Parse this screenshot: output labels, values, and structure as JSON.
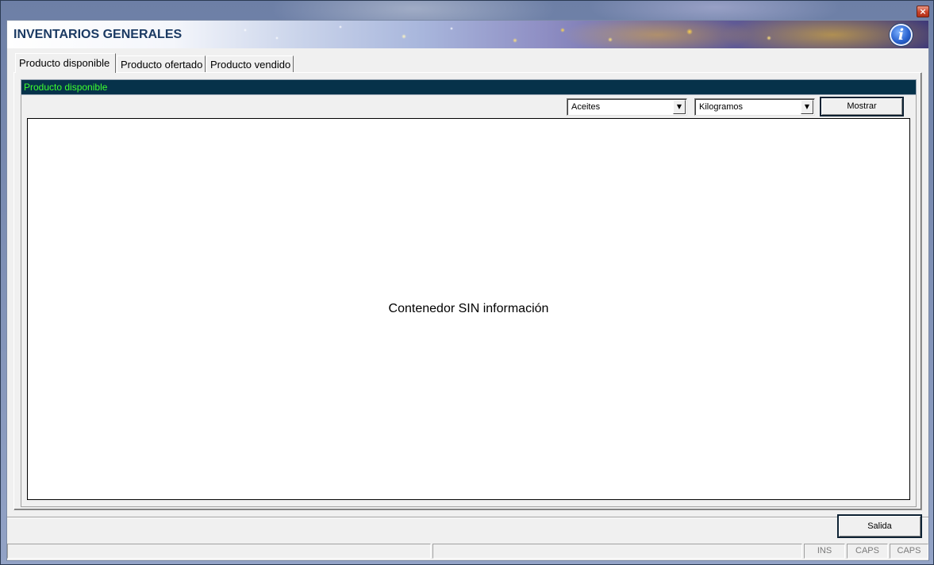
{
  "window": {
    "close_glyph": "×",
    "close_icon": "close-icon"
  },
  "banner": {
    "title": "INVENTARIOS GENERALES",
    "info_glyph": "i",
    "info_icon": "info-icon"
  },
  "tabs": [
    {
      "label": "Producto disponible",
      "active": true
    },
    {
      "label": "Producto ofertado",
      "active": false
    },
    {
      "label": "Producto vendido",
      "active": false
    }
  ],
  "panel": {
    "section_title": "Producto disponible",
    "product_select": {
      "value": "Aceites"
    },
    "unit_select": {
      "value": "Kilogramos"
    },
    "show_button": "Mostrar",
    "empty_message": "Contenedor SIN información"
  },
  "footer": {
    "exit_button": "Salida"
  },
  "status_bar": {
    "cells": [
      "",
      "",
      "INS",
      "CAPS",
      "CAPS"
    ]
  },
  "colors": {
    "section_header_bg": "#06324a",
    "section_title_text": "#3dff2e",
    "banner_title_text": "#1b3a63"
  }
}
